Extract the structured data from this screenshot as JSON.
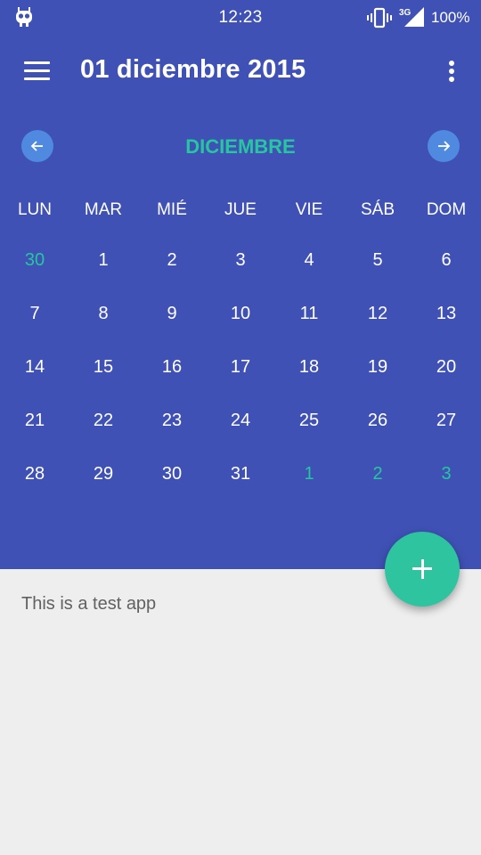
{
  "status_bar": {
    "time": "12:23",
    "network": "3G",
    "battery": "100%",
    "icons": [
      "app-notification-icon",
      "vibrate-icon",
      "signal-3g-icon"
    ]
  },
  "toolbar": {
    "title": "01 diciembre 2015",
    "icons": [
      "menu-icon",
      "overflow-menu-icon"
    ]
  },
  "calendar": {
    "month": "DICIEMBRE",
    "nav_icons": [
      "arrow-left-icon",
      "arrow-right-icon"
    ],
    "weekdays": [
      "LUN",
      "MAR",
      "MIÉ",
      "JUE",
      "VIE",
      "SÁB",
      "DOM"
    ],
    "weeks": [
      [
        "30",
        "1",
        "2",
        "3",
        "4",
        "5",
        "6"
      ],
      [
        "7",
        "8",
        "9",
        "10",
        "11",
        "12",
        "13"
      ],
      [
        "14",
        "15",
        "16",
        "17",
        "18",
        "19",
        "20"
      ],
      [
        "21",
        "22",
        "23",
        "24",
        "25",
        "26",
        "27"
      ],
      [
        "28",
        "29",
        "30",
        "31",
        "1",
        "2",
        "3"
      ]
    ],
    "outside_month": [
      [
        true,
        false,
        false,
        false,
        false,
        false,
        false
      ],
      [
        false,
        false,
        false,
        false,
        false,
        false,
        false
      ],
      [
        false,
        false,
        false,
        false,
        false,
        false,
        false
      ],
      [
        false,
        false,
        false,
        false,
        false,
        false,
        false
      ],
      [
        false,
        false,
        false,
        false,
        true,
        true,
        true
      ]
    ]
  },
  "content": {
    "text": "This is a test app"
  },
  "fab": {
    "icon": "plus-icon"
  },
  "colors": {
    "primary": "#3f51b5",
    "accent": "#26c6a0",
    "nav_button": "#4f8ae0",
    "background": "#eeeeee"
  }
}
